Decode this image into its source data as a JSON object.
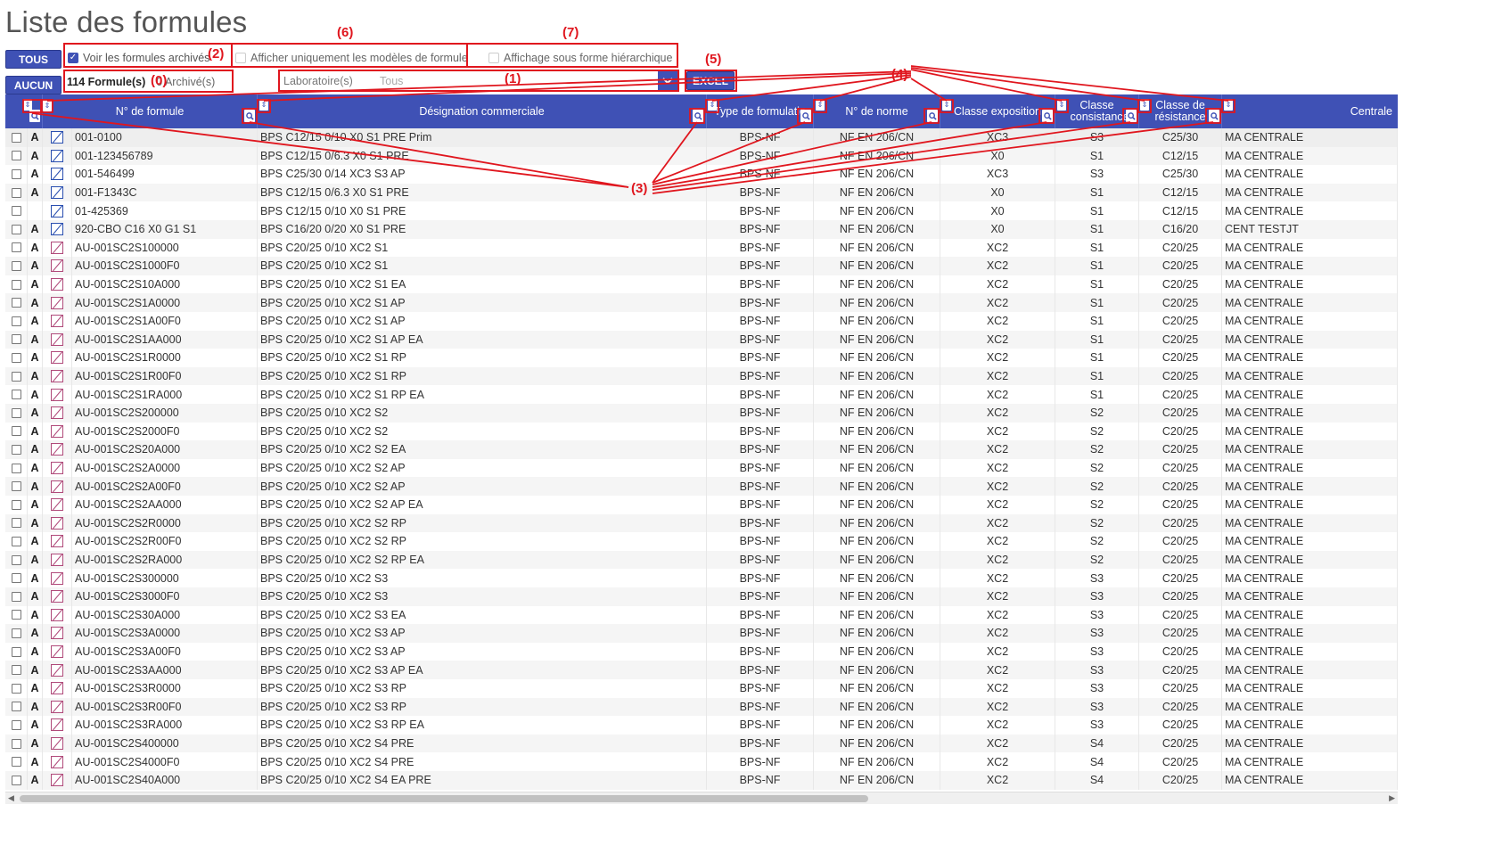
{
  "page": {
    "title": "Liste des formules"
  },
  "toolbar": {
    "tous_label": "TOUS",
    "aucun_label": "AUCUN",
    "archived_label": "Voir les formules archivés",
    "models_label": "Afficher uniquement les modèles de formule",
    "hier_label": "Affichage sous forme hiérarchique",
    "count_label": "114 Formule(s)",
    "archived_count_label": "0 Archivé(s)",
    "lab_label": "Laboratoire(s)",
    "lab_value": "Tous",
    "excel_label": "EXCEL"
  },
  "annotations": {
    "a0": "(0)",
    "a1": "(1)",
    "a2": "(2)",
    "a3": "(3)",
    "a4": "(4)",
    "a5": "(5)",
    "a6": "(6)",
    "a7": "(7)"
  },
  "columns": {
    "num": "N° de formule",
    "des": "Désignation commerciale",
    "type": "Type de formulatio",
    "norm": "N° de norme",
    "exp": "Classe exposition",
    "cons": "Classe consistance",
    "res": "Classe de résistance",
    "cen": "Centrale"
  },
  "colors": {
    "header": "#3f51b5",
    "annotation": "#e0161e"
  },
  "rows": [
    {
      "a": "A",
      "icon": "blue",
      "num": "001-0100",
      "des": "BPS C12/15 0/10 X0 S1 PRE Prim",
      "type": "BPS-NF",
      "norm": "NF EN 206/CN",
      "exp": "XC3",
      "cons": "S3",
      "res": "C25/30",
      "cen": "MA CENTRALE"
    },
    {
      "a": "A",
      "icon": "blue",
      "num": "001-123456789",
      "des": "BPS C12/15 0/6.3 X0 S1 PRE",
      "type": "BPS-NF",
      "norm": "NF EN 206/CN",
      "exp": "X0",
      "cons": "S1",
      "res": "C12/15",
      "cen": "MA CENTRALE"
    },
    {
      "a": "A",
      "icon": "blue",
      "num": "001-546499",
      "des": "BPS C25/30 0/14 XC3 S3 AP",
      "type": "BPS-NF",
      "norm": "NF EN 206/CN",
      "exp": "XC3",
      "cons": "S3",
      "res": "C25/30",
      "cen": "MA CENTRALE"
    },
    {
      "a": "A",
      "icon": "blue",
      "num": "001-F1343C",
      "des": "BPS C12/15 0/6.3 X0 S1 PRE",
      "type": "BPS-NF",
      "norm": "NF EN 206/CN",
      "exp": "X0",
      "cons": "S1",
      "res": "C12/15",
      "cen": "MA CENTRALE"
    },
    {
      "a": "",
      "icon": "blue",
      "num": "01-425369",
      "des": "BPS C12/15 0/10 X0 S1 PRE",
      "type": "BPS-NF",
      "norm": "NF EN 206/CN",
      "exp": "X0",
      "cons": "S1",
      "res": "C12/15",
      "cen": "MA CENTRALE"
    },
    {
      "a": "A",
      "icon": "blue",
      "num": "920-CBO C16 X0 G1 S1",
      "des": "BPS C16/20 0/20 X0 S1 PRE",
      "type": "BPS-NF",
      "norm": "NF EN 206/CN",
      "exp": "X0",
      "cons": "S1",
      "res": "C16/20",
      "cen": "CENT TESTJT"
    },
    {
      "a": "A",
      "icon": "pink",
      "num": "AU-001SC2S100000",
      "des": "BPS C20/25 0/10 XC2 S1",
      "type": "BPS-NF",
      "norm": "NF EN 206/CN",
      "exp": "XC2",
      "cons": "S1",
      "res": "C20/25",
      "cen": "MA CENTRALE"
    },
    {
      "a": "A",
      "icon": "pink",
      "num": "AU-001SC2S1000F0",
      "des": "BPS C20/25 0/10 XC2 S1",
      "type": "BPS-NF",
      "norm": "NF EN 206/CN",
      "exp": "XC2",
      "cons": "S1",
      "res": "C20/25",
      "cen": "MA CENTRALE"
    },
    {
      "a": "A",
      "icon": "pink",
      "num": "AU-001SC2S10A000",
      "des": "BPS C20/25 0/10 XC2 S1 EA",
      "type": "BPS-NF",
      "norm": "NF EN 206/CN",
      "exp": "XC2",
      "cons": "S1",
      "res": "C20/25",
      "cen": "MA CENTRALE"
    },
    {
      "a": "A",
      "icon": "pink",
      "num": "AU-001SC2S1A0000",
      "des": "BPS C20/25 0/10 XC2 S1 AP",
      "type": "BPS-NF",
      "norm": "NF EN 206/CN",
      "exp": "XC2",
      "cons": "S1",
      "res": "C20/25",
      "cen": "MA CENTRALE"
    },
    {
      "a": "A",
      "icon": "pink",
      "num": "AU-001SC2S1A00F0",
      "des": "BPS C20/25 0/10 XC2 S1 AP",
      "type": "BPS-NF",
      "norm": "NF EN 206/CN",
      "exp": "XC2",
      "cons": "S1",
      "res": "C20/25",
      "cen": "MA CENTRALE"
    },
    {
      "a": "A",
      "icon": "pink",
      "num": "AU-001SC2S1AA000",
      "des": "BPS C20/25 0/10 XC2 S1 AP EA",
      "type": "BPS-NF",
      "norm": "NF EN 206/CN",
      "exp": "XC2",
      "cons": "S1",
      "res": "C20/25",
      "cen": "MA CENTRALE"
    },
    {
      "a": "A",
      "icon": "pink",
      "num": "AU-001SC2S1R0000",
      "des": "BPS C20/25 0/10 XC2 S1 RP",
      "type": "BPS-NF",
      "norm": "NF EN 206/CN",
      "exp": "XC2",
      "cons": "S1",
      "res": "C20/25",
      "cen": "MA CENTRALE"
    },
    {
      "a": "A",
      "icon": "pink",
      "num": "AU-001SC2S1R00F0",
      "des": "BPS C20/25 0/10 XC2 S1 RP",
      "type": "BPS-NF",
      "norm": "NF EN 206/CN",
      "exp": "XC2",
      "cons": "S1",
      "res": "C20/25",
      "cen": "MA CENTRALE"
    },
    {
      "a": "A",
      "icon": "pink",
      "num": "AU-001SC2S1RA000",
      "des": "BPS C20/25 0/10 XC2 S1 RP EA",
      "type": "BPS-NF",
      "norm": "NF EN 206/CN",
      "exp": "XC2",
      "cons": "S1",
      "res": "C20/25",
      "cen": "MA CENTRALE"
    },
    {
      "a": "A",
      "icon": "pink",
      "num": "AU-001SC2S200000",
      "des": "BPS C20/25 0/10 XC2 S2",
      "type": "BPS-NF",
      "norm": "NF EN 206/CN",
      "exp": "XC2",
      "cons": "S2",
      "res": "C20/25",
      "cen": "MA CENTRALE"
    },
    {
      "a": "A",
      "icon": "pink",
      "num": "AU-001SC2S2000F0",
      "des": "BPS C20/25 0/10 XC2 S2",
      "type": "BPS-NF",
      "norm": "NF EN 206/CN",
      "exp": "XC2",
      "cons": "S2",
      "res": "C20/25",
      "cen": "MA CENTRALE"
    },
    {
      "a": "A",
      "icon": "pink",
      "num": "AU-001SC2S20A000",
      "des": "BPS C20/25 0/10 XC2 S2 EA",
      "type": "BPS-NF",
      "norm": "NF EN 206/CN",
      "exp": "XC2",
      "cons": "S2",
      "res": "C20/25",
      "cen": "MA CENTRALE"
    },
    {
      "a": "A",
      "icon": "pink",
      "num": "AU-001SC2S2A0000",
      "des": "BPS C20/25 0/10 XC2 S2 AP",
      "type": "BPS-NF",
      "norm": "NF EN 206/CN",
      "exp": "XC2",
      "cons": "S2",
      "res": "C20/25",
      "cen": "MA CENTRALE"
    },
    {
      "a": "A",
      "icon": "pink",
      "num": "AU-001SC2S2A00F0",
      "des": "BPS C20/25 0/10 XC2 S2 AP",
      "type": "BPS-NF",
      "norm": "NF EN 206/CN",
      "exp": "XC2",
      "cons": "S2",
      "res": "C20/25",
      "cen": "MA CENTRALE"
    },
    {
      "a": "A",
      "icon": "pink",
      "num": "AU-001SC2S2AA000",
      "des": "BPS C20/25 0/10 XC2 S2 AP EA",
      "type": "BPS-NF",
      "norm": "NF EN 206/CN",
      "exp": "XC2",
      "cons": "S2",
      "res": "C20/25",
      "cen": "MA CENTRALE"
    },
    {
      "a": "A",
      "icon": "pink",
      "num": "AU-001SC2S2R0000",
      "des": "BPS C20/25 0/10 XC2 S2 RP",
      "type": "BPS-NF",
      "norm": "NF EN 206/CN",
      "exp": "XC2",
      "cons": "S2",
      "res": "C20/25",
      "cen": "MA CENTRALE"
    },
    {
      "a": "A",
      "icon": "pink",
      "num": "AU-001SC2S2R00F0",
      "des": "BPS C20/25 0/10 XC2 S2 RP",
      "type": "BPS-NF",
      "norm": "NF EN 206/CN",
      "exp": "XC2",
      "cons": "S2",
      "res": "C20/25",
      "cen": "MA CENTRALE"
    },
    {
      "a": "A",
      "icon": "pink",
      "num": "AU-001SC2S2RA000",
      "des": "BPS C20/25 0/10 XC2 S2 RP EA",
      "type": "BPS-NF",
      "norm": "NF EN 206/CN",
      "exp": "XC2",
      "cons": "S2",
      "res": "C20/25",
      "cen": "MA CENTRALE"
    },
    {
      "a": "A",
      "icon": "pink",
      "num": "AU-001SC2S300000",
      "des": "BPS C20/25 0/10 XC2 S3",
      "type": "BPS-NF",
      "norm": "NF EN 206/CN",
      "exp": "XC2",
      "cons": "S3",
      "res": "C20/25",
      "cen": "MA CENTRALE"
    },
    {
      "a": "A",
      "icon": "pink",
      "num": "AU-001SC2S3000F0",
      "des": "BPS C20/25 0/10 XC2 S3",
      "type": "BPS-NF",
      "norm": "NF EN 206/CN",
      "exp": "XC2",
      "cons": "S3",
      "res": "C20/25",
      "cen": "MA CENTRALE"
    },
    {
      "a": "A",
      "icon": "pink",
      "num": "AU-001SC2S30A000",
      "des": "BPS C20/25 0/10 XC2 S3 EA",
      "type": "BPS-NF",
      "norm": "NF EN 206/CN",
      "exp": "XC2",
      "cons": "S3",
      "res": "C20/25",
      "cen": "MA CENTRALE"
    },
    {
      "a": "A",
      "icon": "pink",
      "num": "AU-001SC2S3A0000",
      "des": "BPS C20/25 0/10 XC2 S3 AP",
      "type": "BPS-NF",
      "norm": "NF EN 206/CN",
      "exp": "XC2",
      "cons": "S3",
      "res": "C20/25",
      "cen": "MA CENTRALE"
    },
    {
      "a": "A",
      "icon": "pink",
      "num": "AU-001SC2S3A00F0",
      "des": "BPS C20/25 0/10 XC2 S3 AP",
      "type": "BPS-NF",
      "norm": "NF EN 206/CN",
      "exp": "XC2",
      "cons": "S3",
      "res": "C20/25",
      "cen": "MA CENTRALE"
    },
    {
      "a": "A",
      "icon": "pink",
      "num": "AU-001SC2S3AA000",
      "des": "BPS C20/25 0/10 XC2 S3 AP EA",
      "type": "BPS-NF",
      "norm": "NF EN 206/CN",
      "exp": "XC2",
      "cons": "S3",
      "res": "C20/25",
      "cen": "MA CENTRALE"
    },
    {
      "a": "A",
      "icon": "pink",
      "num": "AU-001SC2S3R0000",
      "des": "BPS C20/25 0/10 XC2 S3 RP",
      "type": "BPS-NF",
      "norm": "NF EN 206/CN",
      "exp": "XC2",
      "cons": "S3",
      "res": "C20/25",
      "cen": "MA CENTRALE"
    },
    {
      "a": "A",
      "icon": "pink",
      "num": "AU-001SC2S3R00F0",
      "des": "BPS C20/25 0/10 XC2 S3 RP",
      "type": "BPS-NF",
      "norm": "NF EN 206/CN",
      "exp": "XC2",
      "cons": "S3",
      "res": "C20/25",
      "cen": "MA CENTRALE"
    },
    {
      "a": "A",
      "icon": "pink",
      "num": "AU-001SC2S3RA000",
      "des": "BPS C20/25 0/10 XC2 S3 RP EA",
      "type": "BPS-NF",
      "norm": "NF EN 206/CN",
      "exp": "XC2",
      "cons": "S3",
      "res": "C20/25",
      "cen": "MA CENTRALE"
    },
    {
      "a": "A",
      "icon": "pink",
      "num": "AU-001SC2S400000",
      "des": "BPS C20/25 0/10 XC2 S4 PRE",
      "type": "BPS-NF",
      "norm": "NF EN 206/CN",
      "exp": "XC2",
      "cons": "S4",
      "res": "C20/25",
      "cen": "MA CENTRALE"
    },
    {
      "a": "A",
      "icon": "pink",
      "num": "AU-001SC2S4000F0",
      "des": "BPS C20/25 0/10 XC2 S4 PRE",
      "type": "BPS-NF",
      "norm": "NF EN 206/CN",
      "exp": "XC2",
      "cons": "S4",
      "res": "C20/25",
      "cen": "MA CENTRALE"
    },
    {
      "a": "A",
      "icon": "pink",
      "num": "AU-001SC2S40A000",
      "des": "BPS C20/25 0/10 XC2 S4 EA PRE",
      "type": "BPS-NF",
      "norm": "NF EN 206/CN",
      "exp": "XC2",
      "cons": "S4",
      "res": "C20/25",
      "cen": "MA CENTRALE"
    }
  ]
}
